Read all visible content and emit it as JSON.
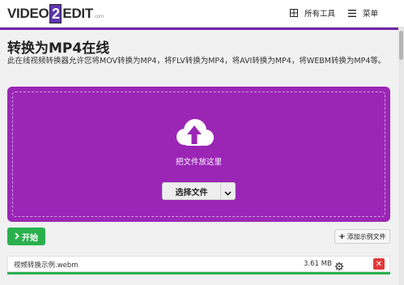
{
  "header": {
    "logo": {
      "left": "VIDEO",
      "badge": "2",
      "right": "EDIT",
      "suffix": ".com"
    },
    "tools_label": "所有工具",
    "menu_label": "菜单",
    "tools_icon": "grid-icon",
    "menu_icon": "hamburger-icon"
  },
  "page": {
    "title": "转换为MP4在线",
    "description": "此在线视频转换器允许您将MOV转换为MP4，将FLV转换为MP4，将AVI转换为MP4，将WEBM转换为MP4等。"
  },
  "dropzone": {
    "icon": "cloud-upload-icon",
    "label": "把文件放这里",
    "choose_button": "选择文件",
    "caret_icon": "chevron-down-icon"
  },
  "actions": {
    "start_button": "开始",
    "sample_button": "添加示例文件"
  },
  "file": {
    "name": "视频转换示例.webm",
    "size": "3.61 MB",
    "settings_icon": "settings-icon",
    "delete_icon": "close-icon",
    "progress": 1.0
  },
  "colors": {
    "brand": "#5d35b3",
    "dropzone": "#9b26b6",
    "start": "#2ab04e",
    "delete": "#e03a3a"
  }
}
